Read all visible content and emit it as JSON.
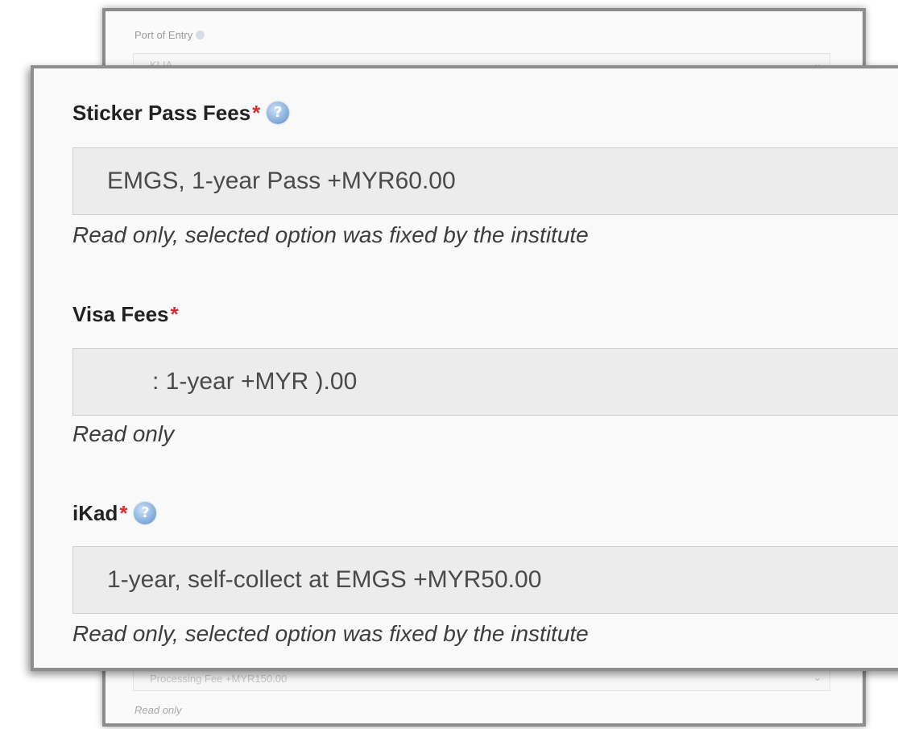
{
  "background_form": {
    "port_of_entry_label": "Port of Entry",
    "port_of_entry_value": "KLIA",
    "processing_fee_value": "Processing Fee +MYR150.00",
    "processing_fee_note": "Read only"
  },
  "fields": [
    {
      "label": "Sticker Pass Fees",
      "required_mark": "*",
      "has_help": true,
      "value": "EMGS, 1-year Pass +MYR60.00",
      "note": "Read only, selected option was fixed by the institute"
    },
    {
      "label": "Visa Fees",
      "required_mark": "*",
      "has_help": false,
      "value": ": 1-year +MYR ).00",
      "note": "Read only"
    },
    {
      "label": "iKad",
      "required_mark": "*",
      "has_help": true,
      "value": "1-year, self-collect at EMGS +MYR50.00",
      "note": "Read only, selected option was fixed by the institute"
    }
  ],
  "icons": {
    "help": "help-question-icon",
    "dropdown": "chevron-down-icon"
  },
  "colors": {
    "required": "#d0302f",
    "help_icon": "#8db4e0",
    "disabled_field": "#ececec"
  }
}
